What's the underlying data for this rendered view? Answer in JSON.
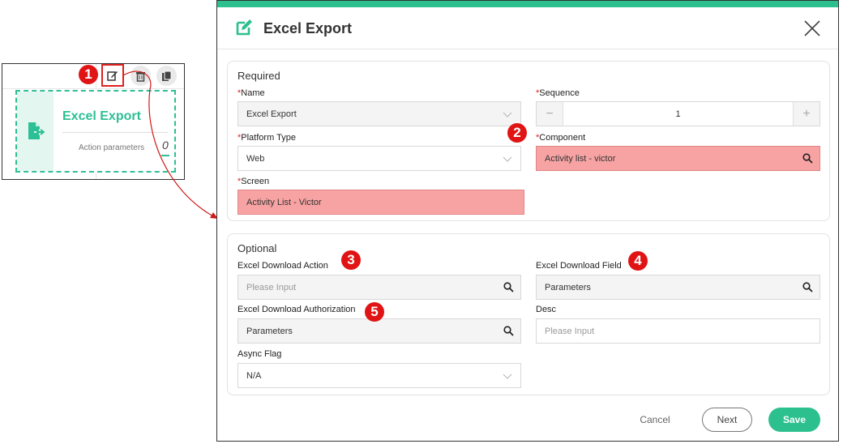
{
  "node_card": {
    "title": "Excel Export",
    "param_label": "Action parameters",
    "param_count": "0",
    "tools": [
      "edit-icon",
      "trash-icon",
      "copy-icon"
    ]
  },
  "callouts": [
    "1",
    "2",
    "3",
    "4",
    "5"
  ],
  "dialog": {
    "title": "Excel Export",
    "required": {
      "title": "Required",
      "name": {
        "label": "Name",
        "value": "Excel Export"
      },
      "sequence": {
        "label": "Sequence",
        "value": "1",
        "minus": "−",
        "plus": "+"
      },
      "platform": {
        "label": "Platform Type",
        "value": "Web"
      },
      "component": {
        "label": "Component",
        "value": "Activity list - victor"
      },
      "screen": {
        "label": "Screen",
        "value": "Activity List - Victor"
      }
    },
    "optional": {
      "title": "Optional",
      "download_action": {
        "label": "Excel Download Action",
        "placeholder": "Please Input"
      },
      "download_field": {
        "label": "Excel Download Field",
        "value": "Parameters"
      },
      "download_auth": {
        "label": "Excel Download Authorization",
        "value": "Parameters"
      },
      "desc": {
        "label": "Desc",
        "placeholder": "Please Input"
      },
      "async": {
        "label": "Async Flag",
        "value": "N/A"
      }
    },
    "footer": {
      "cancel": "Cancel",
      "next": "Next",
      "save": "Save"
    }
  },
  "colors": {
    "accent": "#2dc08f",
    "error_fill": "#f8a3a3",
    "callout": "#e01414"
  }
}
